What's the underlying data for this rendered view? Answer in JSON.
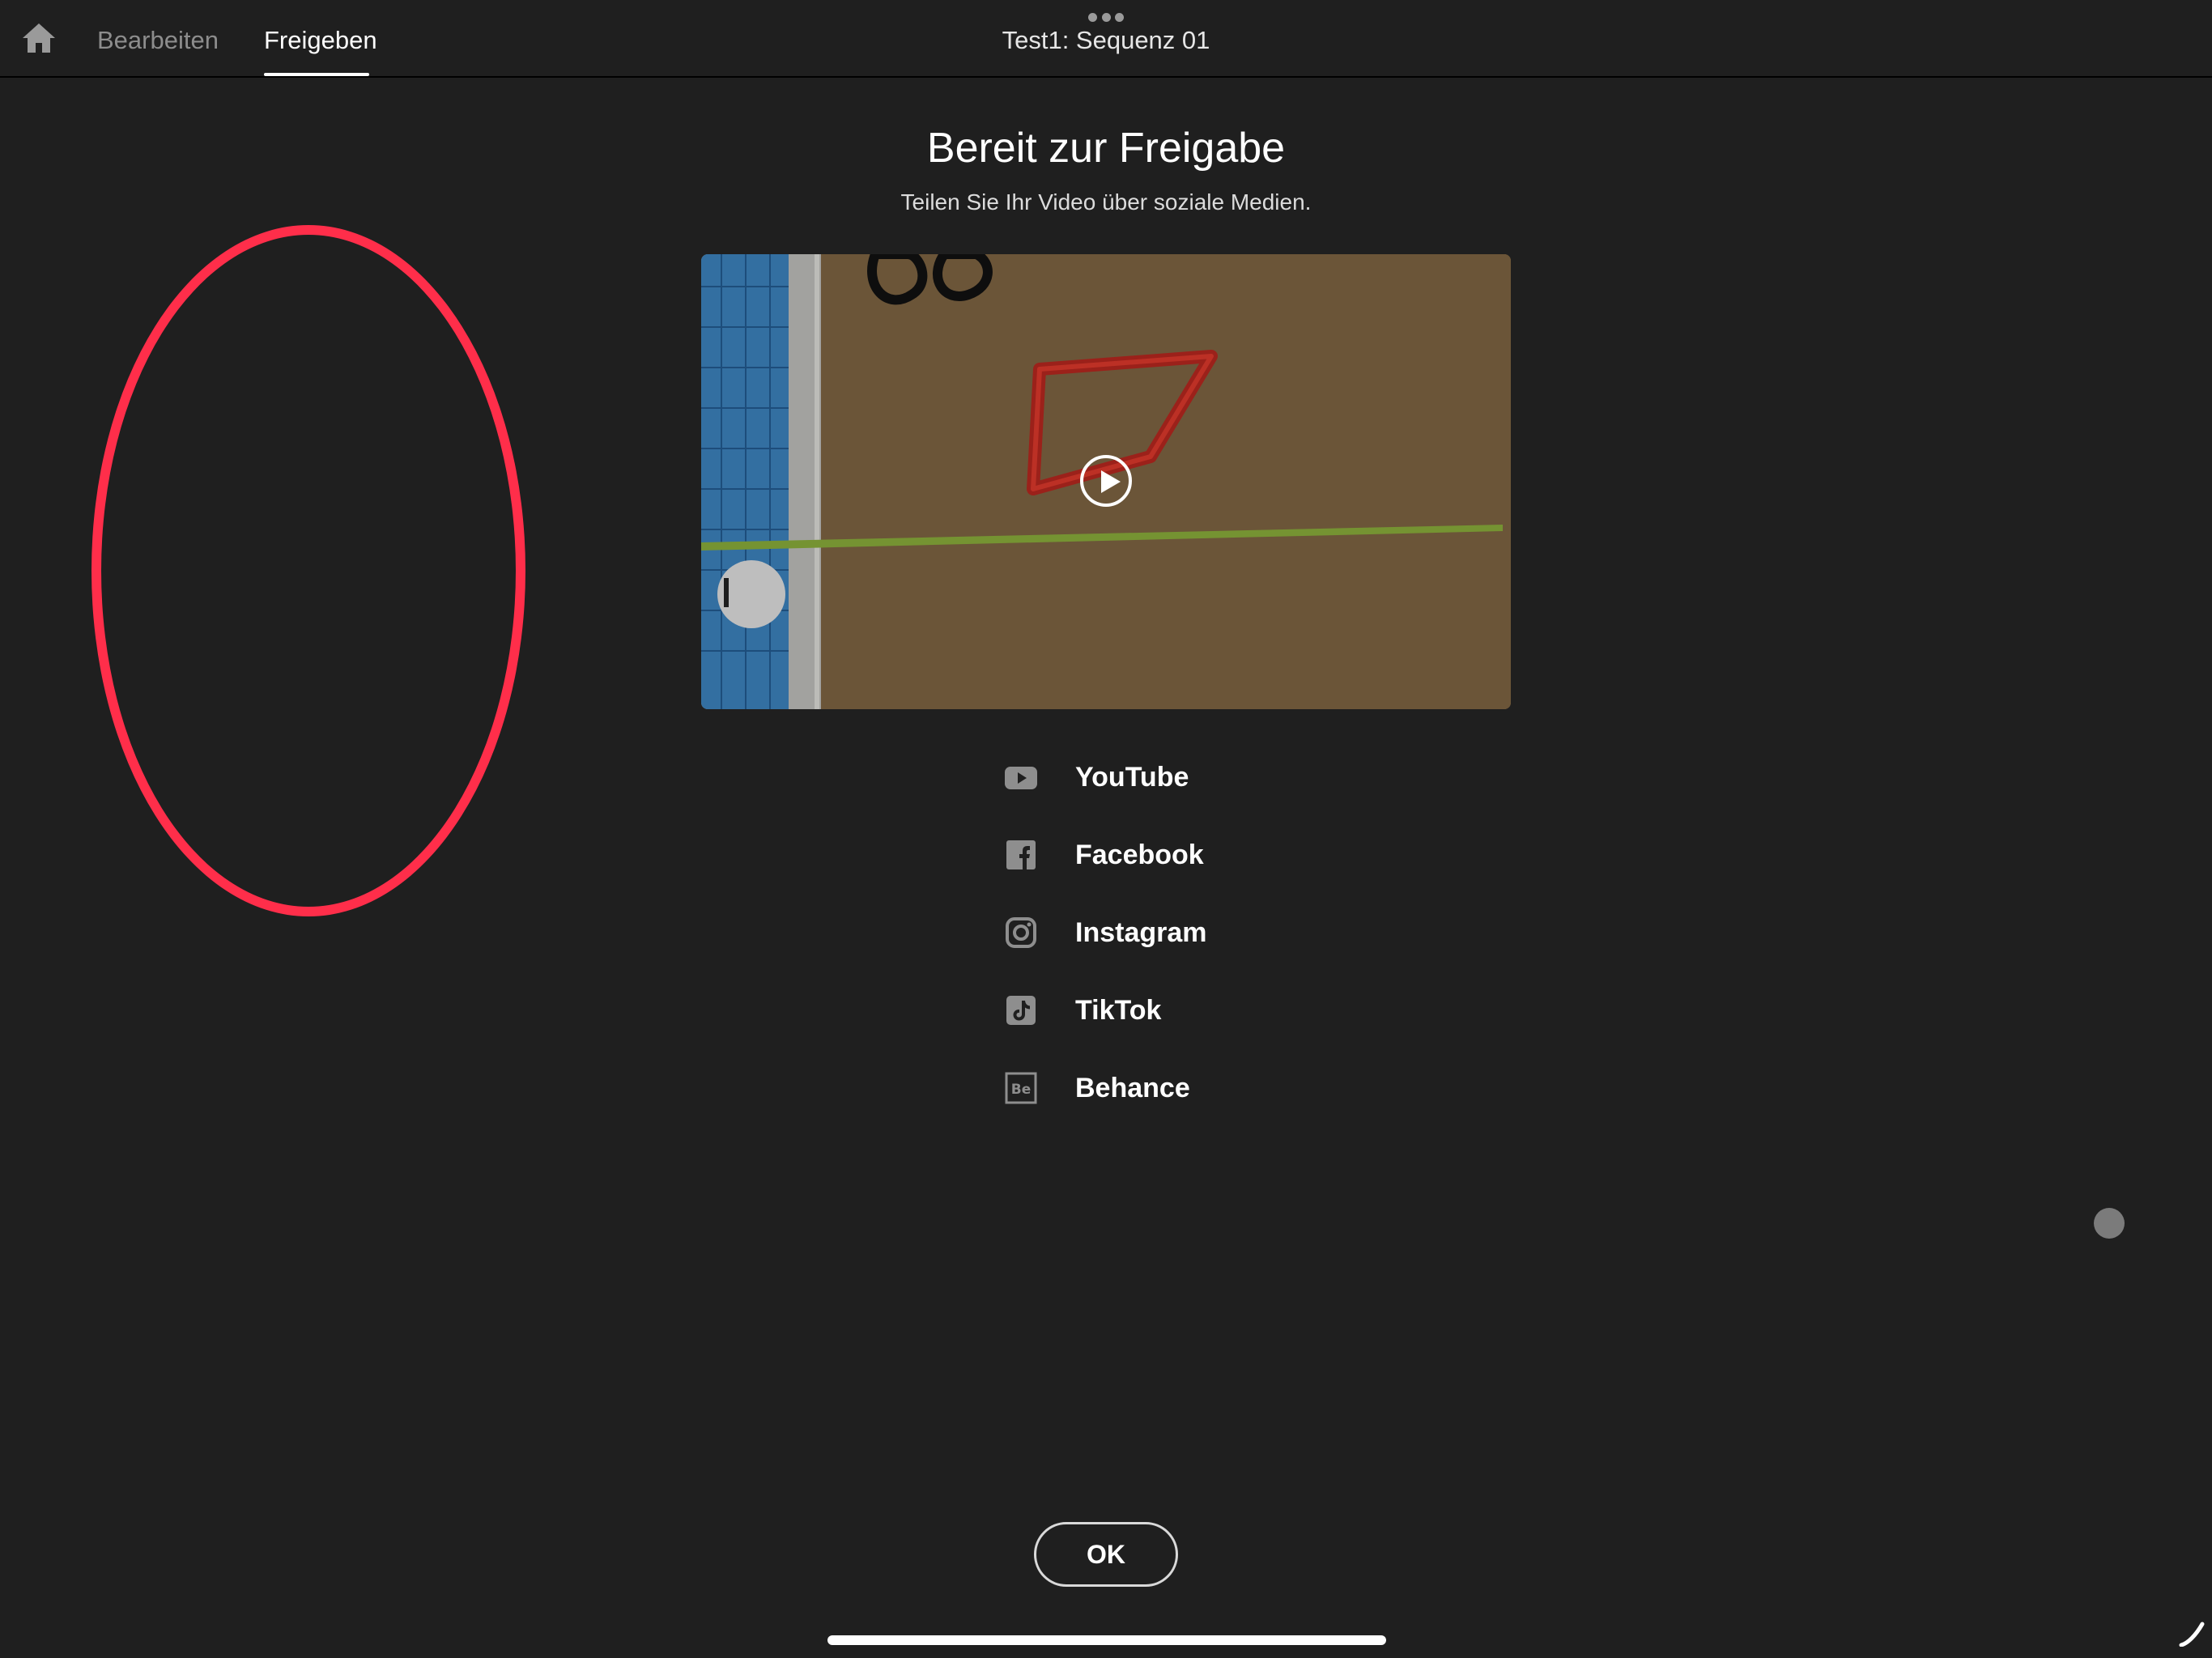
{
  "header": {
    "home_icon": "home-icon",
    "tabs": [
      {
        "label": "Bearbeiten",
        "active": false
      },
      {
        "label": "Freigeben",
        "active": true
      }
    ],
    "more_icon": "ellipsis-icon",
    "document_title": "Test1: Sequenz 01"
  },
  "main": {
    "headline": "Bereit zur Freigabe",
    "subline": "Teilen Sie Ihr Video über soziale Medien.",
    "video": {
      "play_icon": "play-icon"
    },
    "share_targets": [
      {
        "label": "YouTube",
        "icon": "youtube-icon"
      },
      {
        "label": "Facebook",
        "icon": "facebook-icon"
      },
      {
        "label": "Instagram",
        "icon": "instagram-icon"
      },
      {
        "label": "TikTok",
        "icon": "tiktok-icon"
      },
      {
        "label": "Behance",
        "icon": "behance-icon"
      }
    ],
    "ok_label": "OK"
  },
  "colors": {
    "background": "#1f1f1f",
    "annotation": "#ff2e4a",
    "icon_gray": "#8e8e8e",
    "text": "#ffffff"
  }
}
